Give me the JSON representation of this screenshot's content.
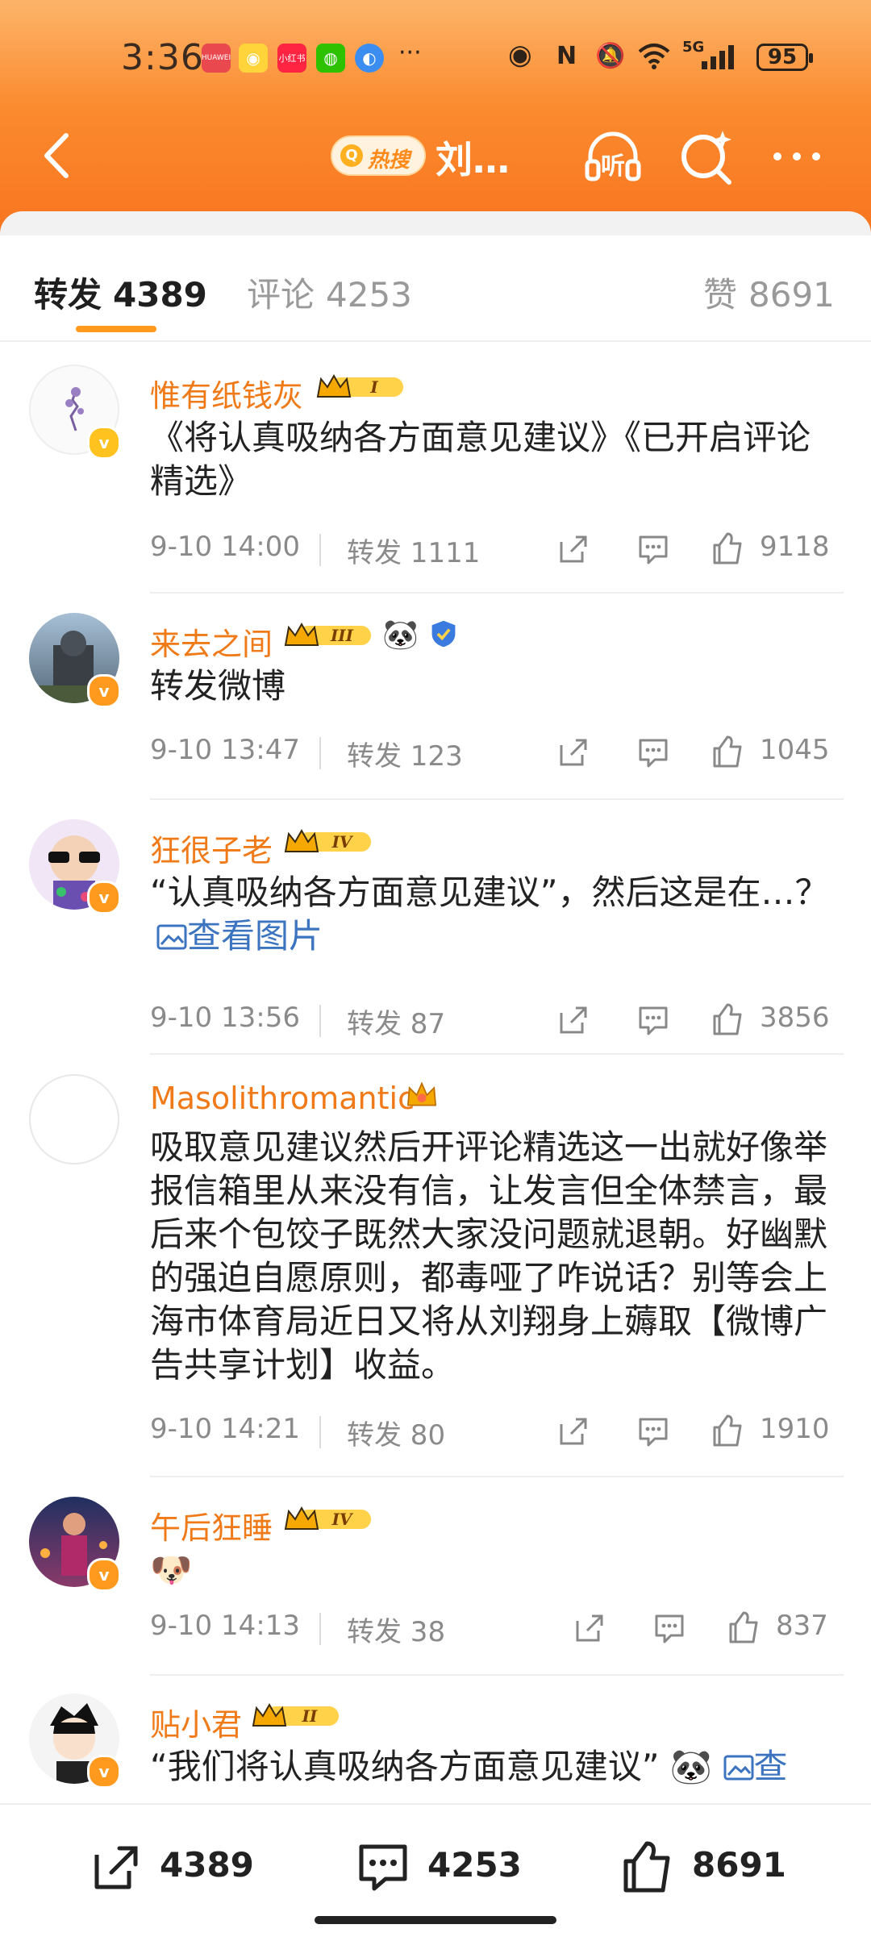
{
  "status_bar": {
    "time": "3:36",
    "apps": [
      "HUAWEI",
      "weibo",
      "小红书",
      "wechat",
      "browser"
    ],
    "more": "···",
    "network": "5G",
    "battery": "95"
  },
  "nav": {
    "hot_search_label": "热搜",
    "title": "刘…",
    "listen_label": "听"
  },
  "tabs": {
    "repost": {
      "label": "转发",
      "count": "4389"
    },
    "comment": {
      "label": "评论",
      "count": "4253"
    },
    "like": {
      "label": "赞",
      "count": "8691"
    }
  },
  "reposts": [
    {
      "user": "惟有纸钱灰",
      "level": "I",
      "text": "《将认真吸纳各方面意见建议》《已开启评论精选》",
      "date": "9-10 14:00",
      "forward": "转发 1111",
      "likes": "9118"
    },
    {
      "user": "来去之间",
      "level": "III",
      "emoji": "🐼",
      "text": "转发微博",
      "date": "9-10 13:47",
      "forward": "转发 123",
      "likes": "1045"
    },
    {
      "user": "狂很子老",
      "level": "IV",
      "text": "“认真吸纳各方面意见建议”，然后这是在…？",
      "link": "查看图片",
      "date": "9-10 13:56",
      "forward": "转发 87",
      "likes": "3856"
    },
    {
      "user": "Masolithromantic",
      "text": "吸取意见建议然后开评论精选这一出就好像举报信箱里从来没有信，让发言但全体禁言，最后来个包饺子既然大家没问题就退朝。好幽默的强迫自愿原则，都毒哑了咋说话？别等会上海市体育局近日又将从刘翔身上薅取【微博广告共享计划】收益。",
      "date": "9-10 14:21",
      "forward": "转发 80",
      "likes": "1910"
    },
    {
      "user": "午后狂睡",
      "level": "IV",
      "text": "🐶",
      "date": "9-10 14:13",
      "forward": "转发 38",
      "likes": "837"
    },
    {
      "user": "贴小君",
      "level": "II",
      "text": "“我们将认真吸纳各方面意见建议”",
      "link": "查",
      "date": "",
      "forward": "",
      "likes": ""
    }
  ],
  "bottom_bar": {
    "repost": "4389",
    "comment": "4253",
    "like": "8691"
  },
  "colors": {
    "accent": "#ff9a1f",
    "username": "#f07a18",
    "link": "#3c74c0",
    "header": "#fb8a2e"
  }
}
